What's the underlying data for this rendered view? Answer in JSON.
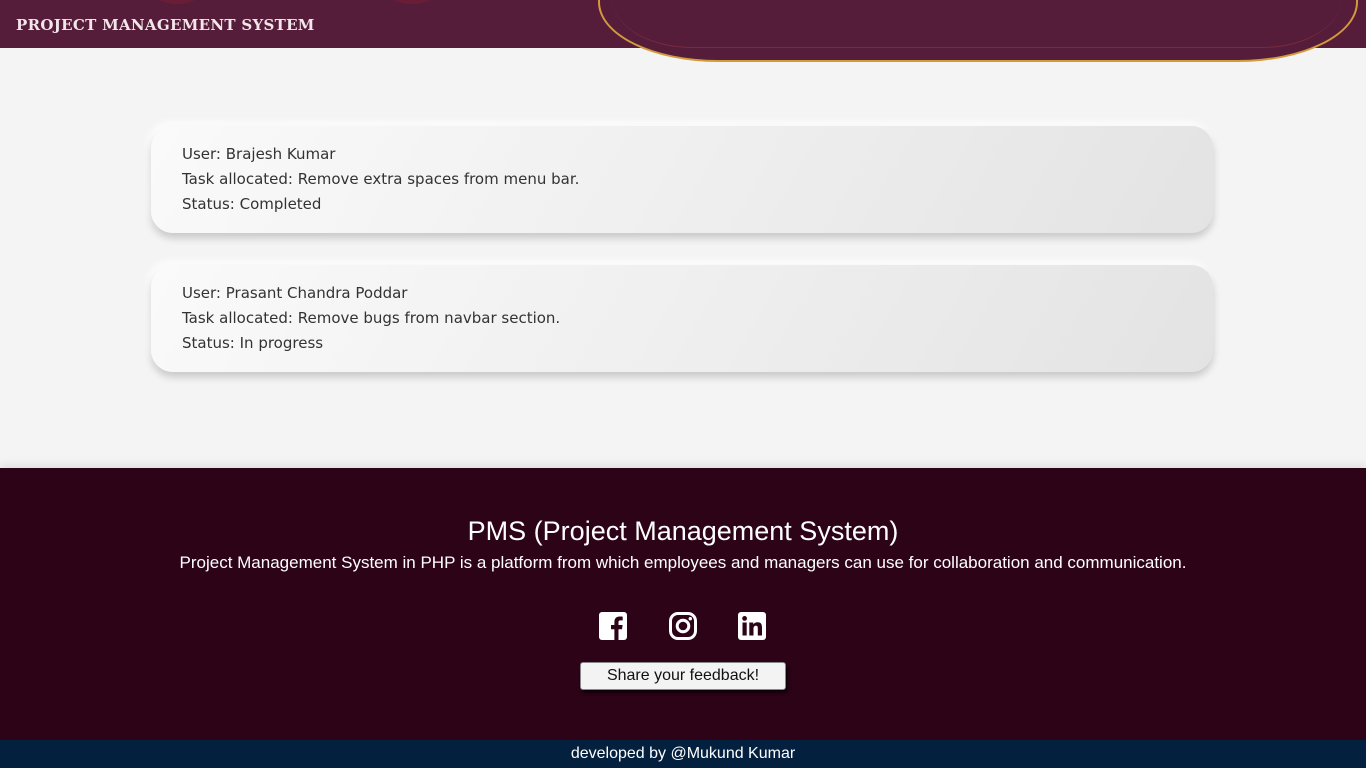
{
  "header": {
    "brand": "PROJECT MANAGEMENT SYSTEM"
  },
  "tasks": [
    {
      "user": "User: Brajesh Kumar",
      "task": "Task allocated: Remove extra spaces from menu bar.",
      "status": "Status: Completed"
    },
    {
      "user": "User: Prasant Chandra Poddar",
      "task": "Task allocated: Remove bugs from navbar section.",
      "status": "Status: In progress"
    }
  ],
  "footer": {
    "title": "PMS (Project Management System)",
    "description": "Project Management System in PHP is a platform from which employees and managers can use for collaboration and communication.",
    "social_icons": [
      "facebook-icon",
      "instagram-icon",
      "linkedin-icon"
    ],
    "feedback_button": "Share your feedback!",
    "credit": "developed by @Mukund Kumar"
  },
  "colors": {
    "navbar": "#561d3b",
    "footer": "#2d0318",
    "credit_bar": "#03203e",
    "accent_arc": "#d39a3d",
    "page_bg": "#f4f4f4"
  }
}
